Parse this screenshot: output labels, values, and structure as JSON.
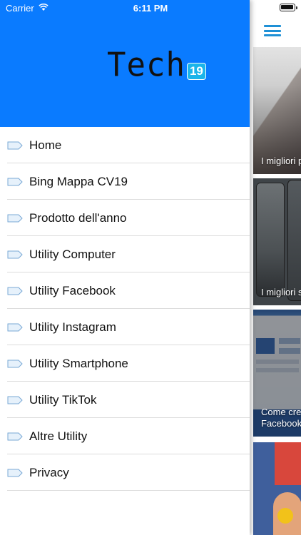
{
  "status_bar": {
    "carrier": "Carrier",
    "time": "6:11 PM"
  },
  "header": {
    "logo_text": "Tech",
    "logo_badge": "19",
    "background_color": "#0a7bff"
  },
  "menu": {
    "items": [
      {
        "label": "Home",
        "icon": "tag-icon"
      },
      {
        "label": "Bing Mappa CV19",
        "icon": "tag-icon"
      },
      {
        "label": "Prodotto dell'anno",
        "icon": "tag-icon"
      },
      {
        "label": "Utility Computer",
        "icon": "tag-icon"
      },
      {
        "label": "Utility Facebook",
        "icon": "tag-icon"
      },
      {
        "label": "Utility Instagram",
        "icon": "tag-icon"
      },
      {
        "label": "Utility Smartphone",
        "icon": "tag-icon"
      },
      {
        "label": "Utility TikTok",
        "icon": "tag-icon"
      },
      {
        "label": "Altre Utility",
        "icon": "tag-icon"
      },
      {
        "label": "Privacy",
        "icon": "tag-icon"
      }
    ]
  },
  "content": {
    "menu_button_icon": "hamburger-menu-icon",
    "accent_color": "#1e90d6",
    "articles": [
      {
        "title": "I migliori p"
      },
      {
        "title": "I migliori s"
      },
      {
        "title": "Come cre\nFacebook"
      },
      {
        "title": ""
      }
    ]
  }
}
